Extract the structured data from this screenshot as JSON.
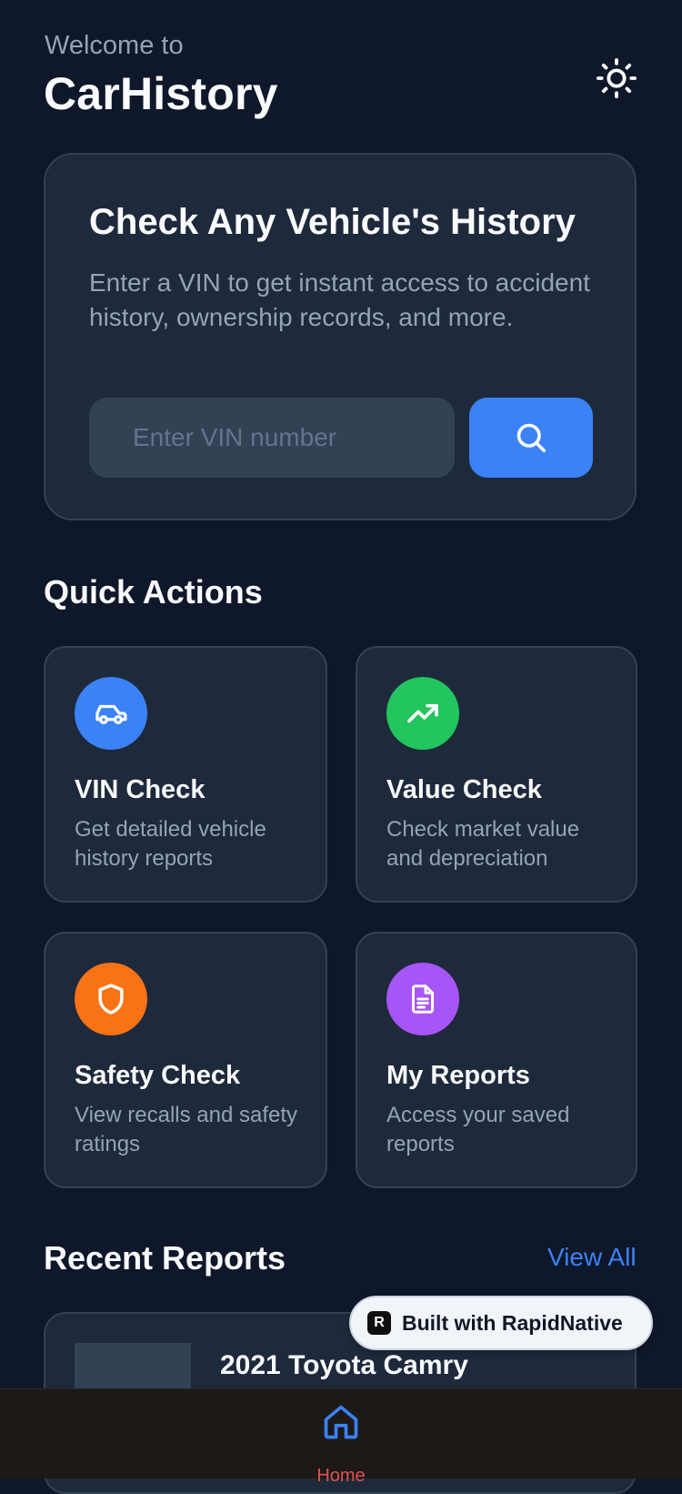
{
  "header": {
    "welcome": "Welcome to",
    "app_title": "CarHistory",
    "theme_icon": "sun-icon"
  },
  "hero": {
    "title": "Check Any Vehicle's History",
    "description": "Enter a VIN to get instant access to accident history, ownership records, and more.",
    "input_placeholder": "Enter VIN number",
    "input_value": "",
    "search_icon": "search-icon"
  },
  "quick_actions": {
    "title": "Quick Actions",
    "items": [
      {
        "title": "VIN Check",
        "description": "Get detailed vehicle history reports",
        "icon": "car-icon",
        "color": "#3b82f6"
      },
      {
        "title": "Value Check",
        "description": "Check market value and depreciation",
        "icon": "trending-up-icon",
        "color": "#22c55e"
      },
      {
        "title": "Safety Check",
        "description": "View recalls and safety ratings",
        "icon": "shield-icon",
        "color": "#f97316"
      },
      {
        "title": "My Reports",
        "description": "Access your saved reports",
        "icon": "document-icon",
        "color": "#a855f7"
      }
    ]
  },
  "recent_reports": {
    "title": "Recent Reports",
    "view_all": "View All",
    "items": [
      {
        "name": "2021 Toyota Camry"
      }
    ]
  },
  "badge": {
    "label": "Built with RapidNative",
    "logo": "R"
  },
  "tabbar": {
    "home_label": "Home",
    "home_icon": "home-icon",
    "active_color": "#3b82f6"
  },
  "colors": {
    "background": "#0f172a",
    "card": "#1e293b",
    "accent": "#3b82f6"
  }
}
